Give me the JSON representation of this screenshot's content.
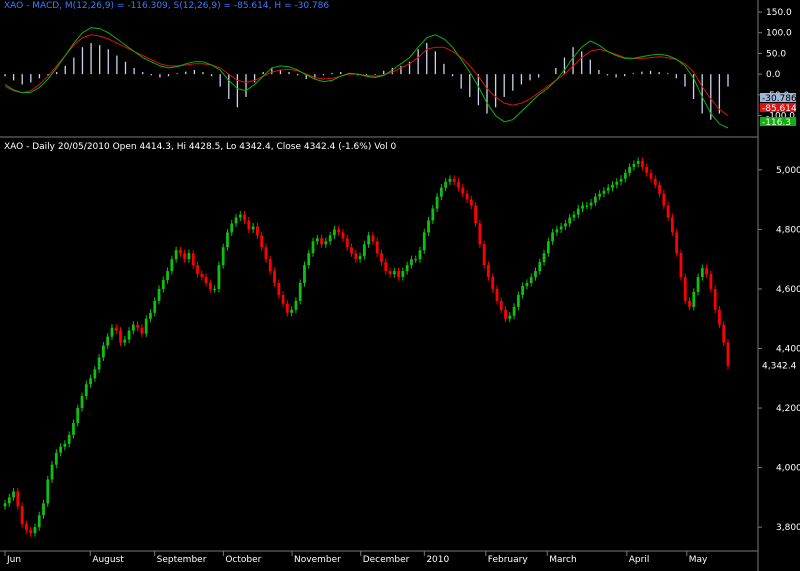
{
  "chart_data": [
    {
      "type": "bar",
      "title": "XAO - MACD, M(12,26,9) = -116.309, S(12,26,9) = -85.614, H = -30.786",
      "ylim": [
        -130,
        150
      ],
      "y_ticks": [
        100.0,
        50.0,
        0.0,
        -50.0,
        -100.0
      ],
      "y_tick_labels": [
        "150.0",
        "100.0",
        "50.0",
        "0.0",
        "-50.0",
        "-100.0"
      ],
      "value_badges": [
        {
          "label": "-30.7862",
          "color": "#9fb6d8"
        },
        {
          "label": "-85.614",
          "color": "#e01010"
        },
        {
          "label": "-116.3",
          "color": "#10b010"
        }
      ],
      "series": [
        {
          "name": "H",
          "color": "#c8d6ee",
          "values": [
            -5,
            -15,
            -25,
            -20,
            -10,
            -3,
            5,
            20,
            40,
            65,
            75,
            70,
            60,
            45,
            30,
            15,
            5,
            -3,
            -8,
            -5,
            2,
            6,
            10,
            5,
            -5,
            -30,
            -60,
            -80,
            -55,
            -20,
            5,
            15,
            10,
            5,
            -3,
            -12,
            -10,
            -3,
            3,
            5,
            2,
            -3,
            -5,
            -2,
            8,
            15,
            20,
            30,
            60,
            75,
            55,
            25,
            -5,
            -35,
            -55,
            -75,
            -95,
            -80,
            -55,
            -40,
            -25,
            -15,
            -8,
            0,
            15,
            40,
            65,
            55,
            35,
            10,
            -3,
            -8,
            -5,
            2,
            6,
            8,
            5,
            2,
            -10,
            -30,
            -60,
            -95,
            -110,
            -95,
            -30
          ]
        },
        {
          "name": "M",
          "color": "#e01010",
          "values": [
            -30,
            -40,
            -45,
            -40,
            -25,
            -5,
            20,
            45,
            70,
            88,
            95,
            92,
            85,
            75,
            65,
            55,
            45,
            35,
            25,
            20,
            20,
            22,
            25,
            25,
            22,
            15,
            0,
            -15,
            -20,
            -15,
            -5,
            5,
            10,
            12,
            8,
            0,
            -8,
            -12,
            -10,
            -5,
            0,
            0,
            -3,
            -5,
            -2,
            5,
            15,
            25,
            40,
            60,
            65,
            65,
            55,
            40,
            20,
            -5,
            -35,
            -55,
            -70,
            -75,
            -70,
            -60,
            -45,
            -30,
            -15,
            0,
            20,
            40,
            55,
            60,
            55,
            48,
            40,
            38,
            38,
            40,
            42,
            40,
            35,
            25,
            5,
            -30,
            -60,
            -85,
            -100
          ]
        },
        {
          "name": "S",
          "color": "#10b010",
          "values": [
            -25,
            -38,
            -45,
            -44,
            -32,
            -12,
            15,
            45,
            75,
            100,
            112,
            110,
            100,
            85,
            70,
            55,
            40,
            30,
            20,
            15,
            18,
            25,
            30,
            30,
            22,
            10,
            -15,
            -35,
            -40,
            -25,
            -5,
            15,
            20,
            18,
            10,
            -2,
            -12,
            -18,
            -15,
            -5,
            2,
            0,
            -5,
            -8,
            -3,
            10,
            25,
            40,
            65,
            88,
            95,
            85,
            65,
            35,
            5,
            -30,
            -70,
            -100,
            -115,
            -110,
            -90,
            -70,
            -50,
            -35,
            -15,
            10,
            40,
            65,
            80,
            70,
            55,
            45,
            38,
            38,
            42,
            46,
            48,
            45,
            36,
            20,
            -10,
            -55,
            -95,
            -120,
            -130
          ]
        }
      ]
    },
    {
      "type": "candlestick",
      "title": "XAO - Daily 20/05/2010 Open 4414.3, Hi 4428.5, Lo 4342.4, Close 4342.4 (-1.6%) Vol 0",
      "ylim": [
        3730,
        5060
      ],
      "y_ticks": [
        5000,
        4800,
        4600,
        4400,
        4200,
        4000,
        3800
      ],
      "y_tick_labels": [
        "5,000",
        "4,800",
        "4,600",
        "4,400",
        "4,200",
        "4,000",
        "3,800"
      ],
      "last_price_label": "4,342.4",
      "last_price": 4342.4,
      "x_labels": [
        "Jun",
        "August",
        "September",
        "October",
        "November",
        "December",
        "2010",
        "February",
        "March",
        "April",
        "May"
      ],
      "up_color": "#10c010",
      "down_color": "#ff0000",
      "close": [
        3880,
        3900,
        3920,
        3870,
        3810,
        3790,
        3780,
        3800,
        3840,
        3880,
        3960,
        4010,
        4050,
        4070,
        4080,
        4110,
        4150,
        4200,
        4240,
        4280,
        4300,
        4330,
        4370,
        4410,
        4440,
        4470,
        4460,
        4420,
        4430,
        4460,
        4480,
        4470,
        4450,
        4500,
        4520,
        4560,
        4600,
        4630,
        4660,
        4700,
        4730,
        4720,
        4700,
        4720,
        4680,
        4650,
        4640,
        4620,
        4600,
        4600,
        4680,
        4740,
        4790,
        4820,
        4840,
        4850,
        4830,
        4800,
        4810,
        4780,
        4740,
        4700,
        4660,
        4620,
        4580,
        4550,
        4520,
        4530,
        4560,
        4620,
        4680,
        4720,
        4760,
        4770,
        4750,
        4760,
        4780,
        4800,
        4790,
        4770,
        4740,
        4720,
        4700,
        4710,
        4750,
        4780,
        4760,
        4720,
        4690,
        4660,
        4650,
        4660,
        4640,
        4660,
        4680,
        4700,
        4700,
        4730,
        4790,
        4830,
        4870,
        4910,
        4940,
        4960,
        4970,
        4960,
        4940,
        4920,
        4900,
        4880,
        4820,
        4750,
        4680,
        4640,
        4600,
        4560,
        4530,
        4500,
        4510,
        4540,
        4580,
        4610,
        4620,
        4640,
        4660,
        4690,
        4720,
        4760,
        4790,
        4800,
        4810,
        4820,
        4840,
        4850,
        4870,
        4880,
        4880,
        4890,
        4910,
        4920,
        4930,
        4940,
        4950,
        4960,
        4970,
        4990,
        5010,
        5020,
        5030,
        5010,
        4990,
        4970,
        4950,
        4920,
        4880,
        4840,
        4790,
        4720,
        4640,
        4560,
        4540,
        4590,
        4640,
        4670,
        4650,
        4600,
        4530,
        4480,
        4420,
        4342
      ]
    }
  ]
}
